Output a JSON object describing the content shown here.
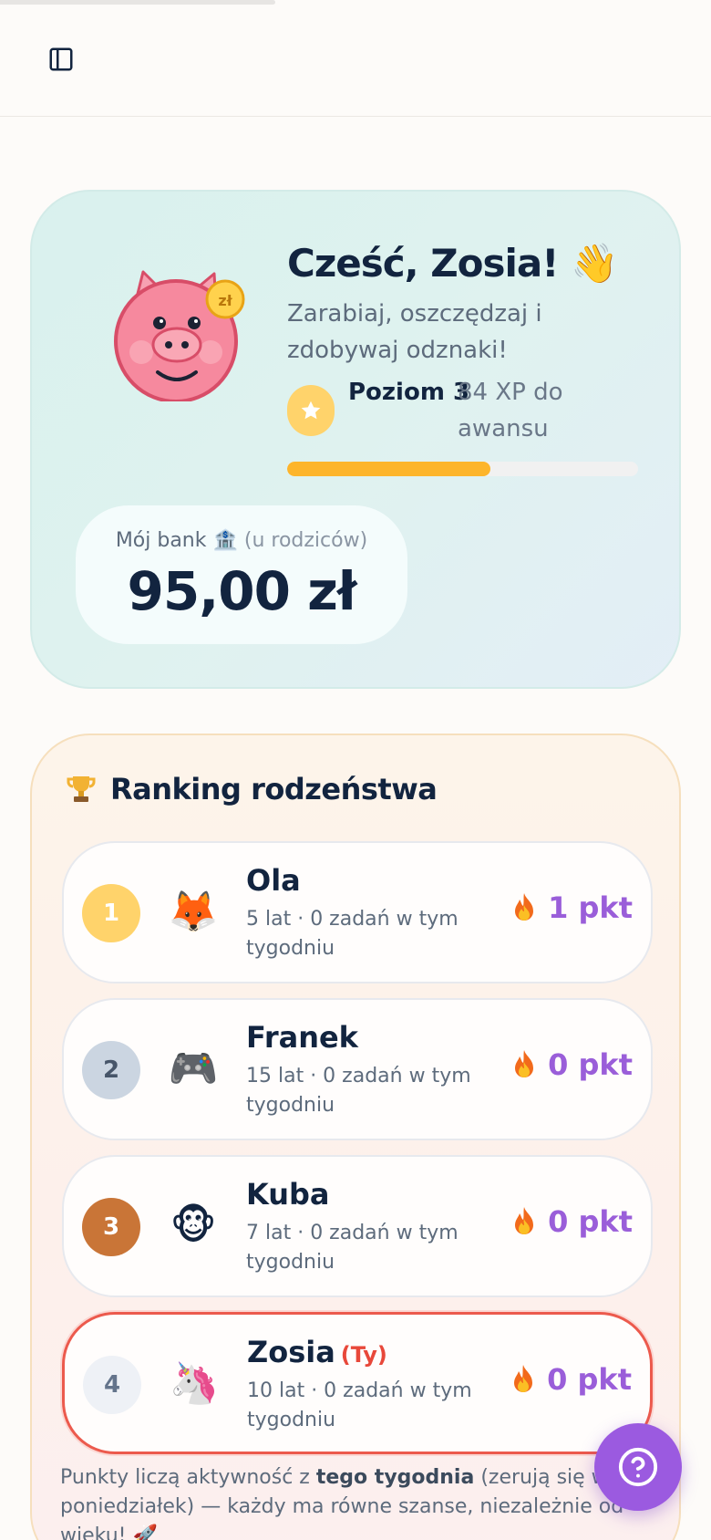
{
  "header": {
    "toggle_icon": "sidebar-panel-icon"
  },
  "hero": {
    "title": "Cześć, Zosia! 👋",
    "subtitle": "Zarabiaj, oszczędzaj i zdobywaj odznaki!",
    "level_label": "Poziom 3",
    "xp_label": "84 XP do awansu",
    "xp_progress_fraction": 0.58,
    "mascot_icon": "piggy-bank-icon",
    "coin_label": "zł",
    "bank": {
      "label": "Mój bank 🏦",
      "label_suffix": "(u rodziców)",
      "amount": "95,00 zł"
    }
  },
  "ranking": {
    "title": "Ranking rodzeństwa",
    "icon": "trophy-icon",
    "rows": [
      {
        "rank": "1",
        "name": "Ola",
        "you": "",
        "avatar": "🦊",
        "meta": "5 lat · 0 zadań w tym tygodniu",
        "score": "1 pkt",
        "rank_color": "#ffd36b",
        "rank_text_color": "#ffffff"
      },
      {
        "rank": "2",
        "name": "Franek",
        "you": "",
        "avatar": "🎮",
        "meta": "15 lat · 0 zadań w tym tygodniu",
        "score": "0 pkt",
        "rank_color": "#cbd5e1",
        "rank_text_color": "#475569"
      },
      {
        "rank": "3",
        "name": "Kuba",
        "you": "",
        "avatar": "🐵",
        "meta": "7 lat · 0 zadań w tym tygodniu",
        "score": "0 pkt",
        "rank_color": "#c97537",
        "rank_text_color": "#ffffff"
      },
      {
        "rank": "4",
        "name": "Zosia",
        "you": "(Ty)",
        "avatar": "🦄",
        "meta": "10 lat · 0 zadań w tym tygodniu",
        "score": "0 pkt",
        "rank_color": "#eef1f6",
        "rank_text_color": "#64748b"
      }
    ],
    "footnote_pre": "Punkty liczą aktywność z ",
    "footnote_bold": "tego tygodnia",
    "footnote_post": " (zerują się w poniedziałek) — każdy ma równe szanse, niezależnie od wieku! 🚀"
  },
  "help_button": {
    "icon": "question-mark-icon"
  },
  "colors": {
    "accent": "#9b5ae0",
    "xp": "#fdb52b",
    "me_border": "#ec5a4d"
  }
}
